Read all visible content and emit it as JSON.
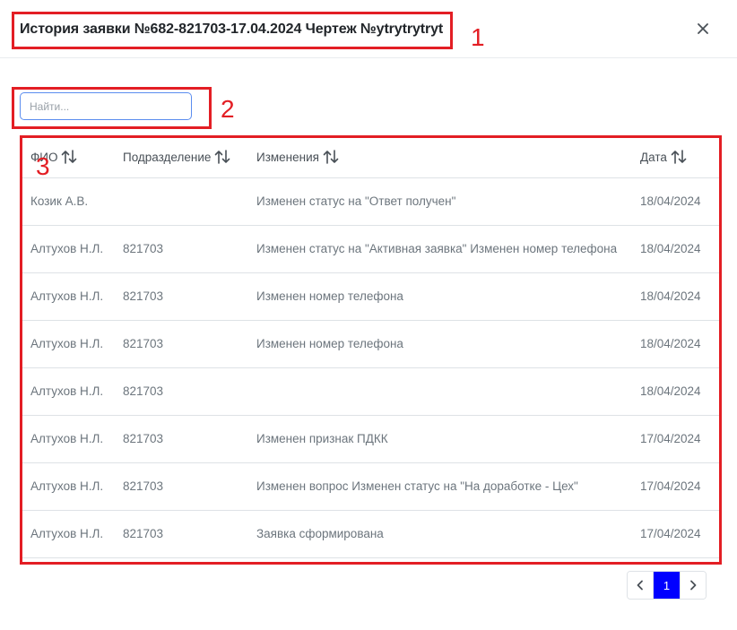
{
  "dialog": {
    "title": "История заявки №682-821703-17.04.2024 Чертеж №ytrytrytryt"
  },
  "annotations": [
    "1",
    "2",
    "3"
  ],
  "search": {
    "placeholder": "Найти...",
    "value": ""
  },
  "table": {
    "columns": [
      "ФИО",
      "Подразделение",
      "Изменения",
      "Дата"
    ],
    "rows": [
      [
        "Козик А.В.",
        "",
        "Изменен статус на \"Ответ получен\"",
        "18/04/2024"
      ],
      [
        "Алтухов Н.Л.",
        "821703",
        "Изменен статус на \"Активная заявка\" Изменен номер телефона",
        "18/04/2024"
      ],
      [
        "Алтухов Н.Л.",
        "821703",
        "Изменен номер телефона",
        "18/04/2024"
      ],
      [
        "Алтухов Н.Л.",
        "821703",
        "Изменен номер телефона",
        "18/04/2024"
      ],
      [
        "Алтухов Н.Л.",
        "821703",
        "",
        "18/04/2024"
      ],
      [
        "Алтухов Н.Л.",
        "821703",
        "Изменен признак ПДКК",
        "17/04/2024"
      ],
      [
        "Алтухов Н.Л.",
        "821703",
        "Изменен вопрос Изменен статус на \"На доработке - Цех\"",
        "17/04/2024"
      ],
      [
        "Алтухов Н.Л.",
        "821703",
        "Заявка сформирована",
        "17/04/2024"
      ]
    ]
  },
  "pagination": {
    "current": "1"
  },
  "icons": {
    "close": "close-icon",
    "sort": "sort-icon",
    "prev": "chevron-left-icon",
    "next": "chevron-right-icon"
  },
  "colors": {
    "annotation": "#e31e24",
    "active_page": "#0000ff",
    "input_border": "#5b8def"
  }
}
